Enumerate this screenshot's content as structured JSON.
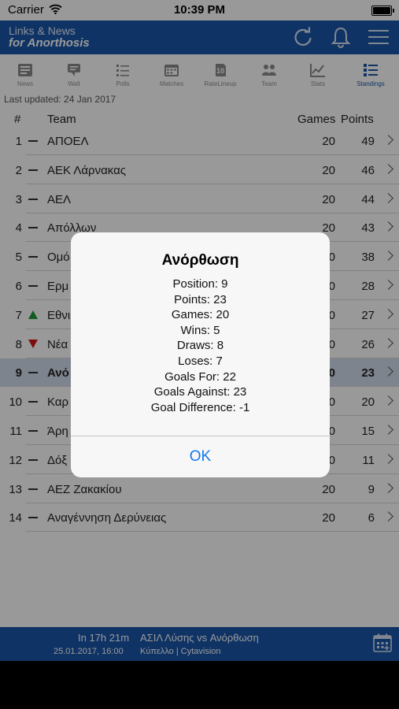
{
  "status_bar": {
    "carrier": "Carrier",
    "time": "10:39 PM"
  },
  "header": {
    "line1": "Links & News",
    "line2": "for Anorthosis"
  },
  "tabs": [
    {
      "label": "News",
      "icon": "news-icon"
    },
    {
      "label": "Wall",
      "icon": "wall-icon"
    },
    {
      "label": "Polls",
      "icon": "polls-icon"
    },
    {
      "label": "Matches",
      "icon": "matches-icon"
    },
    {
      "label": "RateLineup",
      "icon": "rate-lineup-icon"
    },
    {
      "label": "Team",
      "icon": "team-icon"
    },
    {
      "label": "Stats",
      "icon": "stats-icon"
    },
    {
      "label": "Standings",
      "icon": "standings-icon"
    }
  ],
  "last_updated": "Last updated: 24 Jan 2017",
  "table": {
    "headers": {
      "pos": "#",
      "team": "Team",
      "games": "Games",
      "points": "Points"
    },
    "rows": [
      {
        "pos": "1",
        "trend": "same",
        "team": "ΑΠΟΕΛ",
        "games": "20",
        "points": "49"
      },
      {
        "pos": "2",
        "trend": "same",
        "team": "ΑΕΚ Λάρνακας",
        "games": "20",
        "points": "46"
      },
      {
        "pos": "3",
        "trend": "same",
        "team": "ΑΕΛ",
        "games": "20",
        "points": "44"
      },
      {
        "pos": "4",
        "trend": "same",
        "team": "Απόλλων",
        "games": "20",
        "points": "43"
      },
      {
        "pos": "5",
        "trend": "same",
        "team": "Ομό",
        "games": "20",
        "points": "38"
      },
      {
        "pos": "6",
        "trend": "same",
        "team": "Ερμ",
        "games": "20",
        "points": "28"
      },
      {
        "pos": "7",
        "trend": "up",
        "team": "Εθνι",
        "games": "20",
        "points": "27"
      },
      {
        "pos": "8",
        "trend": "down",
        "team": "Νέα",
        "games": "20",
        "points": "26"
      },
      {
        "pos": "9",
        "trend": "same",
        "team": "Ανό",
        "games": "20",
        "points": "23"
      },
      {
        "pos": "10",
        "trend": "same",
        "team": "Καρ",
        "games": "20",
        "points": "20"
      },
      {
        "pos": "11",
        "trend": "same",
        "team": "Άρη",
        "games": "20",
        "points": "15"
      },
      {
        "pos": "12",
        "trend": "same",
        "team": "Δόξ",
        "games": "20",
        "points": "11"
      },
      {
        "pos": "13",
        "trend": "same",
        "team": "ΑΕΖ Ζακακίου",
        "games": "20",
        "points": "9"
      },
      {
        "pos": "14",
        "trend": "same",
        "team": "Αναγέννηση Δερύνειας",
        "games": "20",
        "points": "6"
      }
    ]
  },
  "next_match": {
    "countdown": "In 17h 21m",
    "fixture": "ΑΣΙΛ Λύσης vs Ανόρθωση",
    "datetime": "25.01.2017, 16:00",
    "competition": "Κύπελλο | Cytavision"
  },
  "alert": {
    "title": "Ανόρθωση",
    "lines": [
      "Position: 9",
      "Points: 23",
      "Games: 20",
      "Wins: 5",
      "Draws: 8",
      "Loses: 7",
      "Goals For: 22",
      "Goals Against: 23",
      "Goal Difference: -1"
    ],
    "ok_label": "OK"
  },
  "colors": {
    "brand": "#1a56a8",
    "accent": "#1478f0",
    "trend_up": "#1e9a3b",
    "trend_down": "#d01515"
  }
}
